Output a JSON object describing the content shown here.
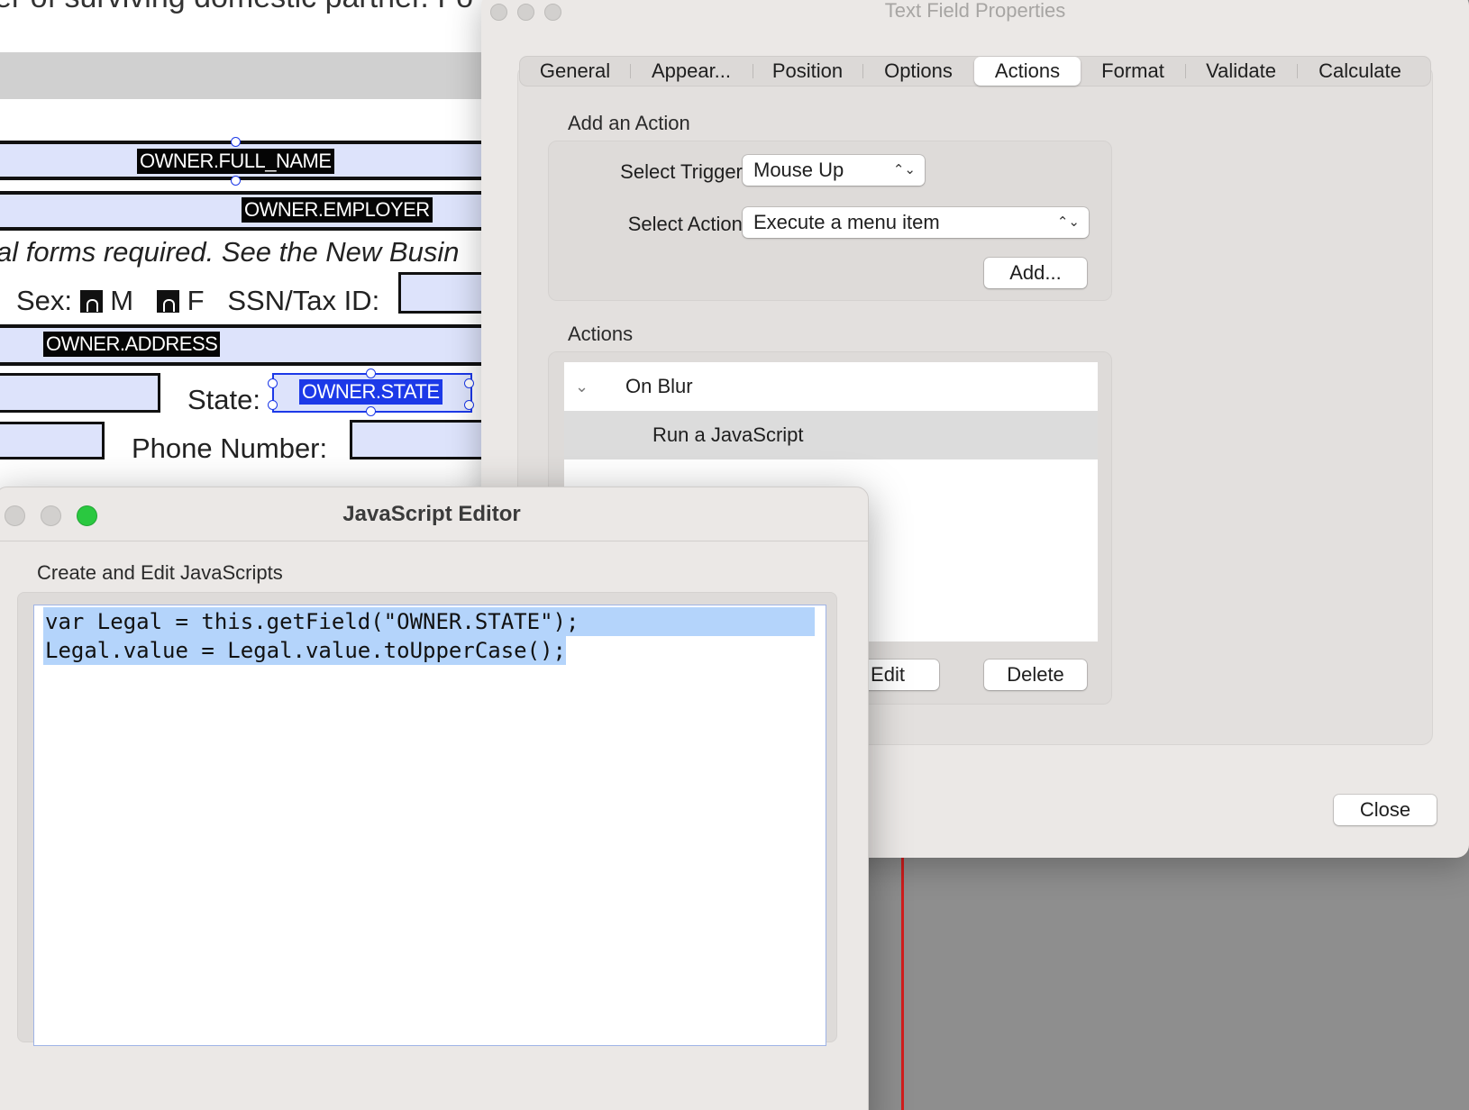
{
  "document": {
    "top_text": "er of surviving domestic partner. Fo",
    "fields": {
      "full_name": "OWNER.FULL_NAME",
      "employer": "OWNER.EMPLOYER",
      "address": "OWNER.ADDRESS",
      "state": "OWNER.STATE"
    },
    "italic_note": "al forms required. See the New Busin",
    "sex_label": "Sex:",
    "sex_m": "M",
    "sex_f": "F",
    "ssn_label": "SSN/Tax ID:",
    "state_label": "State:",
    "phone_label": "Phone Number:"
  },
  "properties_dialog": {
    "title": "Text Field Properties",
    "tabs": [
      "General",
      "Appear...",
      "Position",
      "Options",
      "Actions",
      "Format",
      "Validate",
      "Calculate"
    ],
    "active_tab": "Actions",
    "add_action": {
      "heading": "Add an Action",
      "trigger_label": "Select Trigger:",
      "trigger_value": "Mouse Up",
      "action_label": "Select Action:",
      "action_value": "Execute a menu item",
      "add_button": "Add..."
    },
    "actions": {
      "heading": "Actions",
      "items": [
        {
          "label": "On Blur",
          "expanded": true
        },
        {
          "label": "Run a JavaScript",
          "selected": true
        }
      ],
      "edit_button": "Edit",
      "delete_button": "Delete"
    },
    "close_button": "Close"
  },
  "js_editor": {
    "title": "JavaScript Editor",
    "subtitle": "Create and Edit JavaScripts",
    "code_lines": [
      "var Legal = this.getField(\"OWNER.STATE\");",
      "Legal.value = Legal.value.toUpperCase();"
    ]
  },
  "colors": {
    "field_fill": "#dde3fb",
    "selection_blue": "#1c39e8",
    "code_selection": "#b4d4fb",
    "traffic_green": "#2ac840",
    "dialog_bg": "#ebe8e6"
  }
}
